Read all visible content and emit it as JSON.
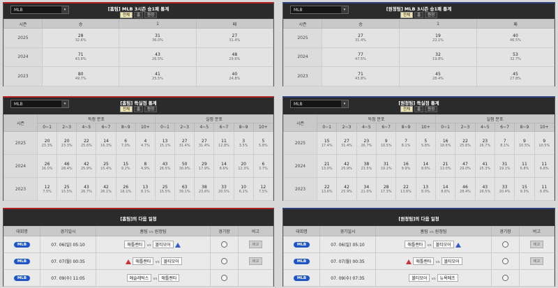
{
  "select_value": "MLB",
  "dropdown_arrow": "▾",
  "tabs": [
    "전체",
    "홈",
    "원정"
  ],
  "stats_header": {
    "season": "시즌",
    "win": "승",
    "draw": "1",
    "loss": "패"
  },
  "home_stats": {
    "title": "[홈팀] MLB 3시즌 승1패 통계",
    "rows": [
      {
        "season": "2025",
        "w": "28",
        "wp": "32.6%",
        "d": "31",
        "dp": "36.0%",
        "l": "27",
        "lp": "31.4%"
      },
      {
        "season": "2024",
        "w": "71",
        "wp": "43.8%",
        "d": "43",
        "dp": "26.5%",
        "l": "48",
        "lp": "29.6%"
      },
      {
        "season": "2023",
        "w": "80",
        "wp": "49.7%",
        "d": "41",
        "dp": "25.5%",
        "l": "40",
        "lp": "24.8%"
      }
    ]
  },
  "away_stats": {
    "title": "[원정팀] MLB 3시즌 승1패 통계",
    "rows": [
      {
        "season": "2025",
        "w": "27",
        "wp": "31.4%",
        "d": "19",
        "dp": "22.1%",
        "l": "40",
        "lp": "46.5%"
      },
      {
        "season": "2024",
        "w": "77",
        "wp": "47.5%",
        "d": "32",
        "dp": "19.8%",
        "l": "53",
        "lp": "32.7%"
      },
      {
        "season": "2023",
        "w": "71",
        "wp": "43.8%",
        "d": "45",
        "dp": "28.4%",
        "l": "45",
        "lp": "27.8%"
      }
    ]
  },
  "score_header": {
    "season": "시즌",
    "scored": "득점 분포",
    "conceded": "실점 분포",
    "ranges": [
      "0~1",
      "2~3",
      "4~5",
      "6~7",
      "8~9",
      "10+"
    ]
  },
  "home_scores": {
    "title": "[홈팀] 득실점 통계",
    "rows": [
      {
        "season": "2025",
        "s": [
          [
            "20",
            "23.3%"
          ],
          [
            "20",
            "23.3%"
          ],
          [
            "22",
            "25.6%"
          ],
          [
            "14",
            "16.3%"
          ],
          [
            "6",
            "7.0%"
          ],
          [
            "4",
            "4.7%"
          ]
        ],
        "c": [
          [
            "13",
            "15.1%"
          ],
          [
            "27",
            "31.4%"
          ],
          [
            "27",
            "31.4%"
          ],
          [
            "11",
            "12.8%"
          ],
          [
            "3",
            "3.5%"
          ],
          [
            "5",
            "5.8%"
          ]
        ]
      },
      {
        "season": "2024",
        "s": [
          [
            "26",
            "16.0%"
          ],
          [
            "46",
            "28.4%"
          ],
          [
            "42",
            "25.9%"
          ],
          [
            "25",
            "15.4%"
          ],
          [
            "15",
            "9.2%"
          ],
          [
            "8",
            "4.9%"
          ]
        ],
        "c": [
          [
            "43",
            "26.5%"
          ],
          [
            "50",
            "30.9%"
          ],
          [
            "29",
            "17.9%"
          ],
          [
            "14",
            "8.6%"
          ],
          [
            "20",
            "12.3%"
          ],
          [
            "6",
            "3.7%"
          ]
        ]
      },
      {
        "season": "2023",
        "s": [
          [
            "12",
            "7.5%"
          ],
          [
            "25",
            "15.5%"
          ],
          [
            "43",
            "26.7%"
          ],
          [
            "42",
            "26.1%"
          ],
          [
            "26",
            "16.1%"
          ],
          [
            "13",
            "8.1%"
          ]
        ],
        "c": [
          [
            "25",
            "15.5%"
          ],
          [
            "63",
            "39.1%"
          ],
          [
            "38",
            "23.6%"
          ],
          [
            "33",
            "20.5%"
          ],
          [
            "10",
            "6.2%"
          ],
          [
            "12",
            "7.5%"
          ]
        ]
      }
    ]
  },
  "away_scores": {
    "title": "[원정팀] 득실점 통계",
    "rows": [
      {
        "season": "2025",
        "s": [
          [
            "15",
            "17.4%"
          ],
          [
            "27",
            "31.4%"
          ],
          [
            "23",
            "26.7%"
          ],
          [
            "9",
            "10.5%"
          ],
          [
            "7",
            "8.1%"
          ],
          [
            "5",
            "5.8%"
          ]
        ],
        "c": [
          [
            "16",
            "18.6%"
          ],
          [
            "22",
            "25.6%"
          ],
          [
            "23",
            "26.7%"
          ],
          [
            "7",
            "8.1%"
          ],
          [
            "9",
            "10.5%"
          ],
          [
            "9",
            "10.5%"
          ]
        ]
      },
      {
        "season": "2024",
        "s": [
          [
            "21",
            "13.0%"
          ],
          [
            "42",
            "25.9%"
          ],
          [
            "38",
            "23.5%"
          ],
          [
            "31",
            "19.1%"
          ],
          [
            "16",
            "9.9%"
          ],
          [
            "14",
            "8.6%"
          ]
        ],
        "c": [
          [
            "21",
            "13.0%"
          ],
          [
            "47",
            "29.0%"
          ],
          [
            "41",
            "25.3%"
          ],
          [
            "31",
            "19.1%"
          ],
          [
            "11",
            "6.8%"
          ],
          [
            "11",
            "6.8%"
          ]
        ]
      },
      {
        "season": "2023",
        "s": [
          [
            "22",
            "13.6%"
          ],
          [
            "42",
            "25.9%"
          ],
          [
            "34",
            "21.0%"
          ],
          [
            "28",
            "17.3%"
          ],
          [
            "22",
            "13.6%"
          ],
          [
            "13",
            "8.0%"
          ]
        ],
        "c": [
          [
            "14",
            "8.6%"
          ],
          [
            "46",
            "28.4%"
          ],
          [
            "43",
            "26.5%"
          ],
          [
            "33",
            "20.4%"
          ],
          [
            "15",
            "9.3%"
          ],
          [
            "11",
            "6.8%"
          ]
        ]
      }
    ]
  },
  "sched_header": {
    "league": "대회명",
    "date": "경기일시",
    "home": "홈팀",
    "vs": "vs",
    "away": "원정팀",
    "venue": "경기장",
    "note": "비고"
  },
  "home_sched": {
    "title": "[홈팀]의 다음 일정",
    "rows": [
      {
        "league": "MLB",
        "date": "07. 06(일) 05:10",
        "home": "애틀랜타",
        "away": "볼티모어",
        "pitcher": "away",
        "note": "비고"
      },
      {
        "league": "MLB",
        "date": "07. 07(월) 00:35",
        "home": "애틀랜타",
        "away": "볼티모어",
        "pitcher": "home",
        "note": "비고"
      },
      {
        "league": "MLB",
        "date": "07. 09(수) 11:05",
        "home": "애슬레틱스",
        "away": "애틀랜타",
        "pitcher": "",
        "note": ""
      }
    ]
  },
  "away_sched": {
    "title": "[원정팀]의 다음 일정",
    "rows": [
      {
        "league": "MLB",
        "date": "07. 06(일) 05:10",
        "home": "애틀랜타",
        "away": "볼티모어",
        "pitcher": "away",
        "note": "비고"
      },
      {
        "league": "MLB",
        "date": "07. 07(월) 00:35",
        "home": "애틀랜타",
        "away": "볼티모어",
        "pitcher": "home",
        "note": "비고"
      },
      {
        "league": "MLB",
        "date": "07. 09(수) 07:35",
        "home": "볼티모어",
        "away": "뉴욕메츠",
        "pitcher": "",
        "note": ""
      }
    ]
  }
}
